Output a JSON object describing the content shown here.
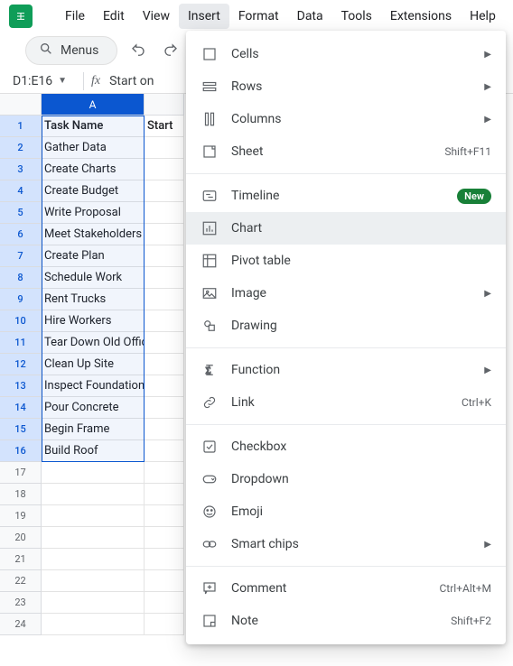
{
  "menubar": {
    "items": [
      "File",
      "Edit",
      "View",
      "Insert",
      "Format",
      "Data",
      "Tools",
      "Extensions",
      "Help"
    ],
    "active": "Insert"
  },
  "toolbar": {
    "omnibox": "Menus"
  },
  "namebox": "D1:E16",
  "formula_bar": "Start on",
  "columns": {
    "A": "A",
    "B_truncated": "Start"
  },
  "rows": [
    {
      "n": 1,
      "a": "Task Name",
      "bold": true
    },
    {
      "n": 2,
      "a": "Gather Data"
    },
    {
      "n": 3,
      "a": "Create Charts"
    },
    {
      "n": 4,
      "a": "Create Budget"
    },
    {
      "n": 5,
      "a": "Write Proposal"
    },
    {
      "n": 6,
      "a": "Meet Stakeholders"
    },
    {
      "n": 7,
      "a": "Create Plan"
    },
    {
      "n": 8,
      "a": "Schedule Work"
    },
    {
      "n": 9,
      "a": "Rent Trucks"
    },
    {
      "n": 10,
      "a": "Hire Workers"
    },
    {
      "n": 11,
      "a": "Tear Down Old Office"
    },
    {
      "n": 12,
      "a": "Clean Up Site"
    },
    {
      "n": 13,
      "a": "Inspect Foundation"
    },
    {
      "n": 14,
      "a": "Pour Concrete"
    },
    {
      "n": 15,
      "a": "Begin Frame"
    },
    {
      "n": 16,
      "a": "Build Roof"
    },
    {
      "n": 17,
      "a": ""
    },
    {
      "n": 18,
      "a": ""
    },
    {
      "n": 19,
      "a": ""
    },
    {
      "n": 20,
      "a": ""
    },
    {
      "n": 21,
      "a": ""
    },
    {
      "n": 22,
      "a": ""
    },
    {
      "n": 23,
      "a": ""
    },
    {
      "n": 24,
      "a": ""
    }
  ],
  "menu": {
    "groups": [
      [
        {
          "icon": "cells",
          "label": "Cells",
          "submenu": true
        },
        {
          "icon": "rows",
          "label": "Rows",
          "submenu": true
        },
        {
          "icon": "columns",
          "label": "Columns",
          "submenu": true
        },
        {
          "icon": "sheet",
          "label": "Sheet",
          "shortcut": "Shift+F11"
        }
      ],
      [
        {
          "icon": "timeline",
          "label": "Timeline",
          "badge": "New"
        },
        {
          "icon": "chart",
          "label": "Chart",
          "hover": true
        },
        {
          "icon": "pivot",
          "label": "Pivot table"
        },
        {
          "icon": "image",
          "label": "Image",
          "submenu": true
        },
        {
          "icon": "drawing",
          "label": "Drawing"
        }
      ],
      [
        {
          "icon": "function",
          "label": "Function",
          "submenu": true
        },
        {
          "icon": "link",
          "label": "Link",
          "shortcut": "Ctrl+K"
        }
      ],
      [
        {
          "icon": "checkbox",
          "label": "Checkbox"
        },
        {
          "icon": "dropdown",
          "label": "Dropdown"
        },
        {
          "icon": "emoji",
          "label": "Emoji"
        },
        {
          "icon": "chips",
          "label": "Smart chips",
          "submenu": true
        }
      ],
      [
        {
          "icon": "comment",
          "label": "Comment",
          "shortcut": "Ctrl+Alt+M"
        },
        {
          "icon": "note",
          "label": "Note",
          "shortcut": "Shift+F2"
        }
      ]
    ]
  }
}
